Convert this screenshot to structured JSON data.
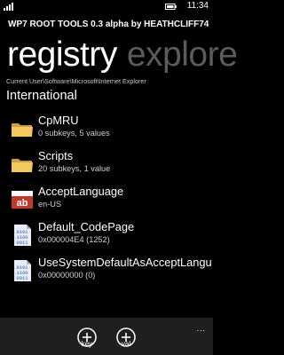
{
  "status_bar": {
    "time": "11:34",
    "signal_icon": "signal-bars-icon",
    "battery_icon": "battery-icon"
  },
  "app": {
    "title": "WP7 ROOT TOOLS 0.3 alpha by HEATHCLIFF74"
  },
  "pivot": {
    "active": "registry",
    "inactive": "explore"
  },
  "path": "Current User\\Software\\Microsoft\\Internet Explorer",
  "current_key": "International",
  "items": [
    {
      "icon": "folder-icon",
      "name": "CpMRU",
      "detail": "0 subkeys, 5 values"
    },
    {
      "icon": "folder-icon",
      "name": "Scripts",
      "detail": "20 subkeys, 1 value"
    },
    {
      "icon": "string-value-icon",
      "icon_text": "ab",
      "name": "AcceptLanguage",
      "detail": "en-US"
    },
    {
      "icon": "binary-value-icon",
      "name": "Default_CodePage",
      "detail": "0x000004E4 (1252)"
    },
    {
      "icon": "binary-value-icon",
      "name": "UseSystemDefaultAsAcceptLanguag",
      "detail": "0x00000000 (0)"
    }
  ],
  "appbar": {
    "buttons": [
      {
        "icon": "add-icon",
        "label": "key"
      },
      {
        "icon": "add-icon",
        "label": "val"
      }
    ],
    "more_icon": "ellipsis-icon",
    "more_text": "..."
  },
  "colors": {
    "background": "#000000",
    "foreground": "#ffffff",
    "folder": "#f3c85e",
    "string_icon": "#c0392b",
    "appbar": "#1f1f1f"
  }
}
